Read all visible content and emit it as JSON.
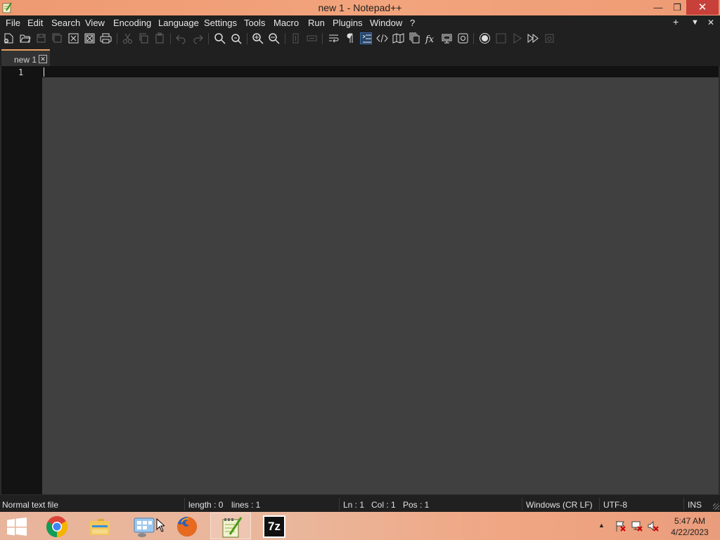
{
  "window": {
    "title": "new 1 - Notepad++",
    "min_glyph": "—",
    "max_glyph": "❐",
    "close_glyph": "✕"
  },
  "menu": {
    "items": [
      "File",
      "Edit",
      "Search",
      "View",
      "Encoding",
      "Language",
      "Settings",
      "Tools",
      "Macro",
      "Run",
      "Plugins",
      "Window",
      "?"
    ],
    "right_plus": "+",
    "right_down": "▼",
    "right_close": "✕"
  },
  "toolbar": {
    "icons": [
      "new-file-icon",
      "open-file-icon",
      "save-icon",
      "save-all-icon",
      "close-icon",
      "close-all-icon",
      "print-icon",
      "cut-icon",
      "copy-icon",
      "paste-icon",
      "undo-icon",
      "redo-icon",
      "find-icon",
      "replace-icon",
      "zoom-in-icon",
      "zoom-out-icon",
      "sync-vertical-icon",
      "sync-horizontal-icon",
      "word-wrap-icon",
      "show-all-characters-icon",
      "indent-guide-icon",
      "xml-tag-icon",
      "document-map-icon",
      "document-list-icon",
      "function-list-icon",
      "folder-workspace-icon",
      "monitoring-icon",
      "record-macro-icon",
      "stop-macro-icon",
      "play-macro-icon",
      "run-macro-multiple-icon",
      "save-macro-icon"
    ]
  },
  "tab": {
    "label": "new 1",
    "close_glyph": "✕"
  },
  "editor": {
    "line_number": "1"
  },
  "status": {
    "file_type": "Normal text file",
    "length": "length : 0",
    "lines": "lines : 1",
    "ln": "Ln : 1",
    "col": "Col : 1",
    "pos": "Pos : 1",
    "eol": "Windows (CR LF)",
    "encoding": "UTF-8",
    "mode": "INS"
  },
  "taskbar": {
    "apps": [
      "start-icon",
      "chrome-icon",
      "file-explorer-icon",
      "control-panel-icon",
      "firefox-icon",
      "notepadpp-icon",
      "7zip-icon"
    ],
    "sevenzip_label": "7z",
    "tray_up": "▲",
    "time": "5:47 AM",
    "date": "4/22/2023"
  },
  "colors": {
    "titlebar": "#f2a47c",
    "close_button": "#c7403a",
    "chrome_bg": "#202020",
    "editor_bg": "#404040",
    "gutter_bg": "#131313",
    "tab_accent": "#e8a05f"
  }
}
